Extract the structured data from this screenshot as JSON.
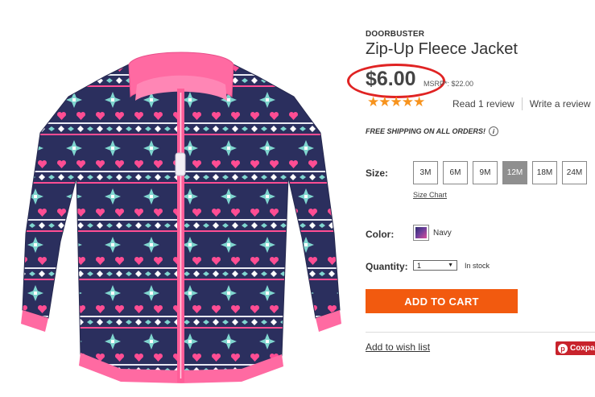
{
  "product": {
    "badge": "DOORBUSTER",
    "title": "Zip-Up Fleece Jacket",
    "price": "$6.00",
    "msrp": "MSRP*: $22.00",
    "rating_stars": "★★★★★",
    "rating_value": 5,
    "read_reviews": "Read 1 review",
    "write_review": "Write a review",
    "shipping": "FREE SHIPPING ON ALL ORDERS!",
    "info_glyph": "i"
  },
  "size": {
    "label": "Size:",
    "options": [
      "3M",
      "6M",
      "9M",
      "12M",
      "18M",
      "24M"
    ],
    "selected": "12M",
    "chart_link": "Size Chart"
  },
  "color": {
    "label": "Color:",
    "value": "Navy"
  },
  "quantity": {
    "label": "Quantity:",
    "value": "1",
    "arrow": "▼",
    "stock": "In stock"
  },
  "actions": {
    "add_to_cart": "ADD TO CART",
    "wishlist": "Add to wish list",
    "pin_glyph": "p",
    "pin_label": "Coxpa"
  },
  "colors": {
    "accent": "#f25a0f",
    "stars": "#f7931d",
    "highlight_circle": "#e02323",
    "pin": "#c8232c"
  }
}
